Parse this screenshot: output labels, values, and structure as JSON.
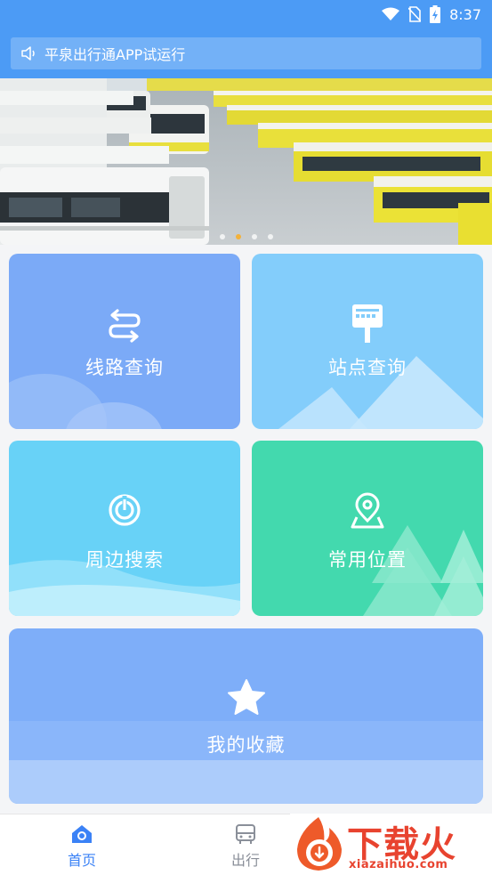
{
  "status_bar": {
    "time": "8:37"
  },
  "notice": {
    "text": "平泉出行通APP试运行"
  },
  "banner": {
    "slide_count": 4,
    "active_slide": 2
  },
  "tiles": [
    {
      "label": "线路查询",
      "icon": "route-swap-icon",
      "color": "#7baaf7"
    },
    {
      "label": "站点查询",
      "icon": "bus-stop-sign-icon",
      "color": "#83cdfb"
    },
    {
      "label": "周边搜索",
      "icon": "radar-icon",
      "color": "#68d2f7"
    },
    {
      "label": "常用位置",
      "icon": "location-pin-icon",
      "color": "#43d9ae"
    },
    {
      "label": "我的收藏",
      "icon": "star-icon",
      "color": "#7eaef9"
    }
  ],
  "tabbar": {
    "items": [
      {
        "label": "首页",
        "icon": "home-icon",
        "active": true
      },
      {
        "label": "出行",
        "icon": "bus-icon",
        "active": false
      }
    ],
    "active_color": "#3b82f6"
  },
  "watermark": {
    "brand": "下载火",
    "url": "xiazaihuo.com"
  }
}
